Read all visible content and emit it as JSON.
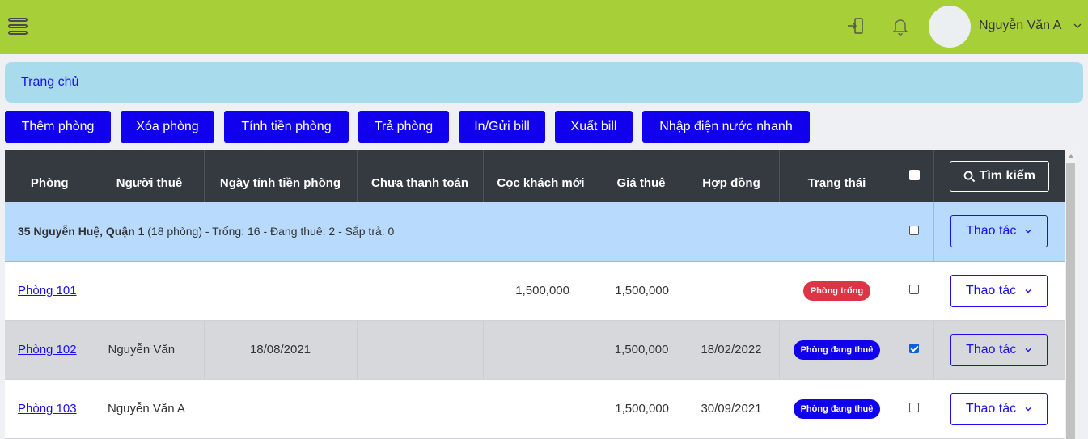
{
  "header": {
    "user_name": "Nguyễn Văn A",
    "icons": [
      "menu-icon",
      "logout-icon",
      "bell-icon",
      "chevron-down-icon"
    ],
    "colors": {
      "topbar": "#a6cf38",
      "primary": "#1100ee"
    }
  },
  "breadcrumb": {
    "home": "Trang chủ"
  },
  "actions": {
    "add_room": "Thêm phòng",
    "delete_room": "Xóa phòng",
    "calc_rent": "Tính tiền phòng",
    "return_room": "Trả phòng",
    "print_bill": "In/Gửi bill",
    "export_bill": "Xuất bill",
    "quick_utility": "Nhập điện nước nhanh"
  },
  "table": {
    "headers": {
      "room": "Phòng",
      "tenant": "Người thuê",
      "billing_date": "Ngày tính tiền phòng",
      "unpaid": "Chưa thanh toán",
      "deposit": "Cọc khách mới",
      "price": "Giá thuê",
      "contract": "Hợp đồng",
      "status": "Trạng thái",
      "search": "Tìm kiếm"
    },
    "group": {
      "address": "35 Nguyễn Huệ, Quận 1",
      "summary": " (18 phòng) - Trống: 16 - Đang thuê: 2 - Sắp trả: 0",
      "action": "Thao tác"
    },
    "rows": [
      {
        "room": "Phòng 101",
        "tenant": "",
        "billing_date": "",
        "unpaid": "",
        "deposit": "1,500,000",
        "price": "1,500,000",
        "contract": "",
        "status": "Phòng trống",
        "status_color": "#dc3545",
        "checked": false,
        "action": "Thao tác"
      },
      {
        "room": "Phòng 102",
        "tenant": "Nguyễn Văn",
        "billing_date": "18/08/2021",
        "unpaid": "",
        "deposit": "",
        "price": "1,500,000",
        "contract": "18/02/2022",
        "status": "Phòng đang thuê",
        "status_color": "#1100ee",
        "checked": true,
        "action": "Thao tác"
      },
      {
        "room": "Phòng 103",
        "tenant": "Nguyễn Văn A",
        "billing_date": "",
        "unpaid": "",
        "deposit": "",
        "price": "1,500,000",
        "contract": "30/09/2021",
        "status": "Phòng đang thuê",
        "status_color": "#1100ee",
        "checked": false,
        "action": "Thao tác"
      }
    ]
  }
}
